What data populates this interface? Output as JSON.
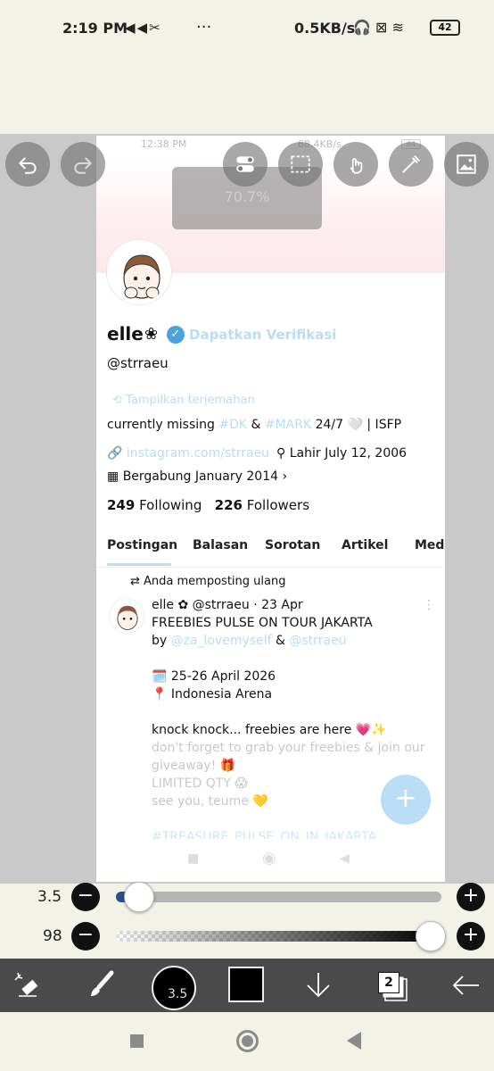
{
  "status_bar": {
    "time": "2:19 PM",
    "app_icons": "◀◀✂",
    "more": "···",
    "speed": "0.5KB/s",
    "right_icons": "🎧 ⊠ ≋",
    "battery": "42"
  },
  "canvas": {
    "zoom": "70.7%",
    "inner_status": {
      "time": "12:38 PM",
      "speed": "68.4KB/s",
      "battery": "64"
    },
    "profile": {
      "name": "elle",
      "flower": "❀",
      "verify_link": "Dapatkan Verifikasi",
      "handle": "@strraeu",
      "translate": "Tampilkan terjemahan",
      "bio_prefix": "currently missing ",
      "bio_tag1": "#DK",
      "bio_amp": " & ",
      "bio_tag2": "#MARK",
      "bio_suffix": " 24/7 🤍 | ISFP",
      "website": "instagram.com/strraeu",
      "birth": "Lahir July 12, 2006",
      "joined": "Bergabung January 2014",
      "following_count": "249",
      "following_label": "Following",
      "followers_count": "226",
      "followers_label": "Followers"
    },
    "tabs": [
      "Postingan",
      "Balasan",
      "Sorotan",
      "Artikel",
      "Medi"
    ],
    "post": {
      "repost_label": "Anda memposting ulang",
      "author": "elle ✿ @strraeu · 23 Apr",
      "more": "⋮",
      "line1": "FREEBIES PULSE ON TOUR JAKARTA",
      "line2_prefix": "by ",
      "line2_mention1": "@za_lovemyself",
      "line2_amp": " & ",
      "line2_mention2": "@strraeu",
      "date": "🗓️ 25-26 April 2026",
      "venue": "📍 Indonesia Arena",
      "knock": "knock knock... freebies are here 💗✨",
      "faded1": "don't forget to grab your freebies & join our",
      "faded2": "giveaway! 🎁",
      "faded3": "LIMITED QTY 😱",
      "faded4": "see you, teume 💛",
      "hashtag": "#TREASURE_PULSE_ON_IN_JAKARTA",
      "fab": "+"
    }
  },
  "sliders": {
    "size_label": "3.5",
    "size_value": 0.07,
    "opacity_label": "98",
    "opacity_value": 0.98,
    "minus": "−",
    "plus": "+"
  },
  "toolbar": {
    "brush_size": "3.5",
    "layers_count": "2",
    "color": "#000000"
  },
  "icons": [
    "undo-icon",
    "redo-icon",
    "toggle-icon",
    "selection-icon",
    "hand-icon",
    "eyedropper-icon",
    "image-icon",
    "magic-eraser-icon",
    "brush-icon",
    "download-icon",
    "layers-icon",
    "back-arrow-icon"
  ]
}
